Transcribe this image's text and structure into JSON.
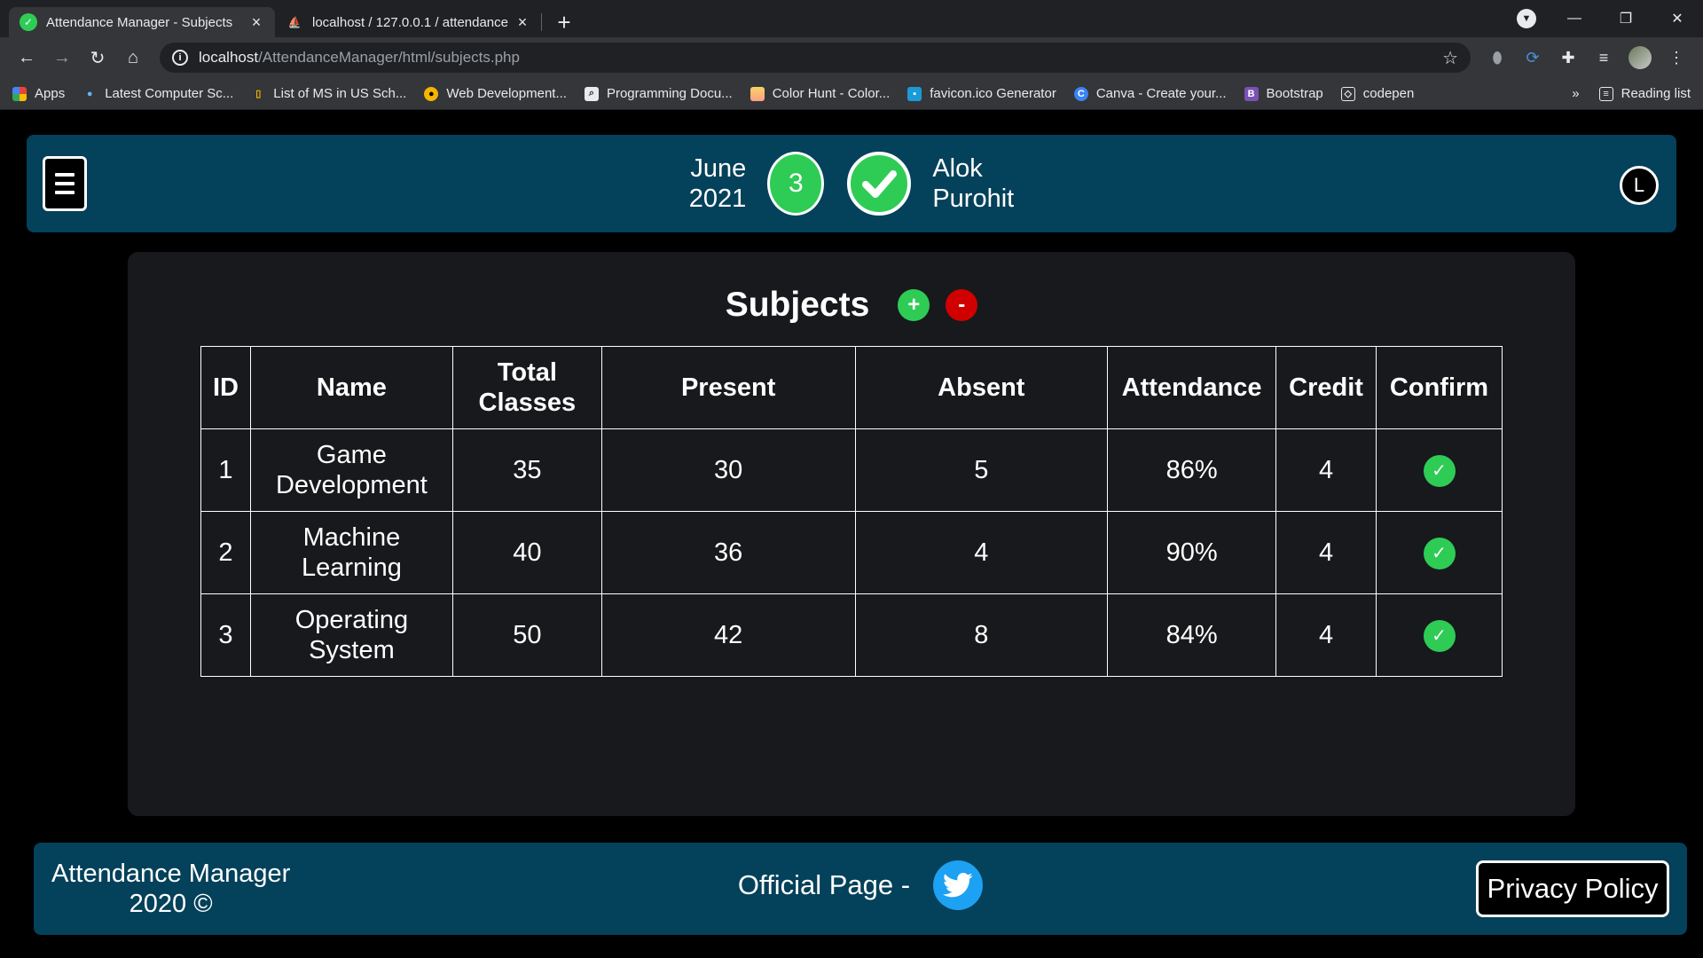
{
  "browser": {
    "tabs": [
      {
        "title": "Attendance Manager - Subjects",
        "active": true
      },
      {
        "title": "localhost / 127.0.0.1 / attendance",
        "active": false
      }
    ],
    "address": {
      "host": "localhost",
      "path": "/AttendanceManager/html/subjects.php"
    },
    "bookmarks": [
      {
        "label": "Apps",
        "icon": "apps-grid-icon"
      },
      {
        "label": "Latest Computer Sc...",
        "icon": "bulb-icon"
      },
      {
        "label": "List of MS in US Sch...",
        "icon": "bookmark-icon"
      },
      {
        "label": "Web Development...",
        "icon": "web-icon"
      },
      {
        "label": "Programming Docu...",
        "icon": "docs-icon"
      },
      {
        "label": "Color Hunt - Color...",
        "icon": "colorhunt-icon"
      },
      {
        "label": "favicon.ico Generator",
        "icon": "favicon-icon"
      },
      {
        "label": "Canva - Create your...",
        "icon": "canva-icon"
      },
      {
        "label": "Bootstrap",
        "icon": "bootstrap-icon"
      },
      {
        "label": "codepen",
        "icon": "codepen-icon"
      }
    ],
    "more_bookmarks": "»",
    "reading_list": "Reading list"
  },
  "header": {
    "month": "June",
    "year": "2021",
    "day": "3",
    "first_name": "Alok",
    "last_name": "Purohit",
    "logout_label": "L",
    "accent_color": "#2ecc55",
    "bar_color": "#04415a"
  },
  "subjects": {
    "title": "Subjects",
    "add_label": "+",
    "remove_label": "-",
    "columns": [
      "ID",
      "Name",
      "Total Classes",
      "Present",
      "Absent",
      "Attendance",
      "Credit",
      "Confirm"
    ],
    "rows": [
      {
        "id": "1",
        "name": "Game Development",
        "total": "35",
        "present": "30",
        "absent": "5",
        "attendance": "86%",
        "credit": "4"
      },
      {
        "id": "2",
        "name": "Machine Learning",
        "total": "40",
        "present": "36",
        "absent": "4",
        "attendance": "90%",
        "credit": "4"
      },
      {
        "id": "3",
        "name": "Operating System",
        "total": "50",
        "present": "42",
        "absent": "8",
        "attendance": "84%",
        "credit": "4"
      }
    ]
  },
  "footer": {
    "app_name": "Attendance Manager",
    "copyright": "2020 ©",
    "official_page": "Official Page -",
    "privacy": "Privacy Policy"
  }
}
